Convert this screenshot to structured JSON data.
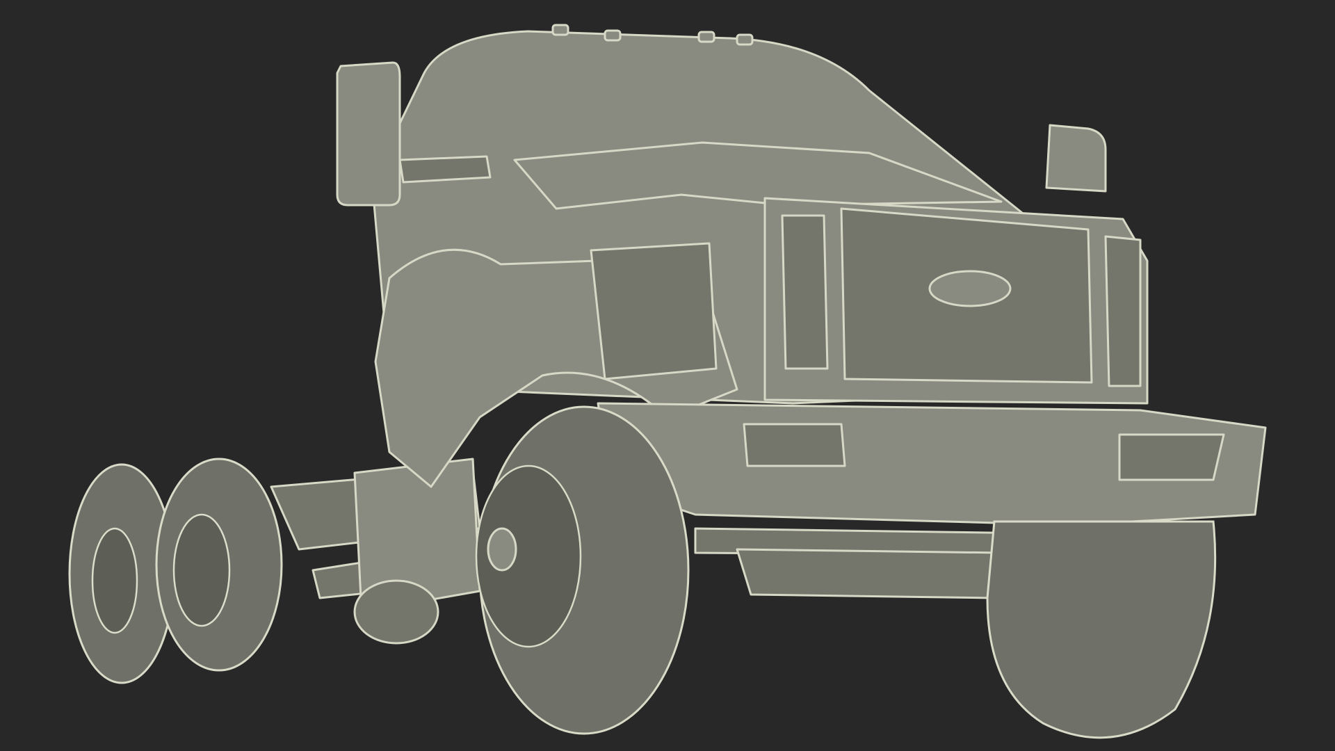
{
  "scene": {
    "subject-icon": "truck-chassis-wireframe-icon",
    "colors": {
      "background": "#282828",
      "body_fill": "#8a8b80",
      "wire": "#d7d8c6"
    }
  }
}
